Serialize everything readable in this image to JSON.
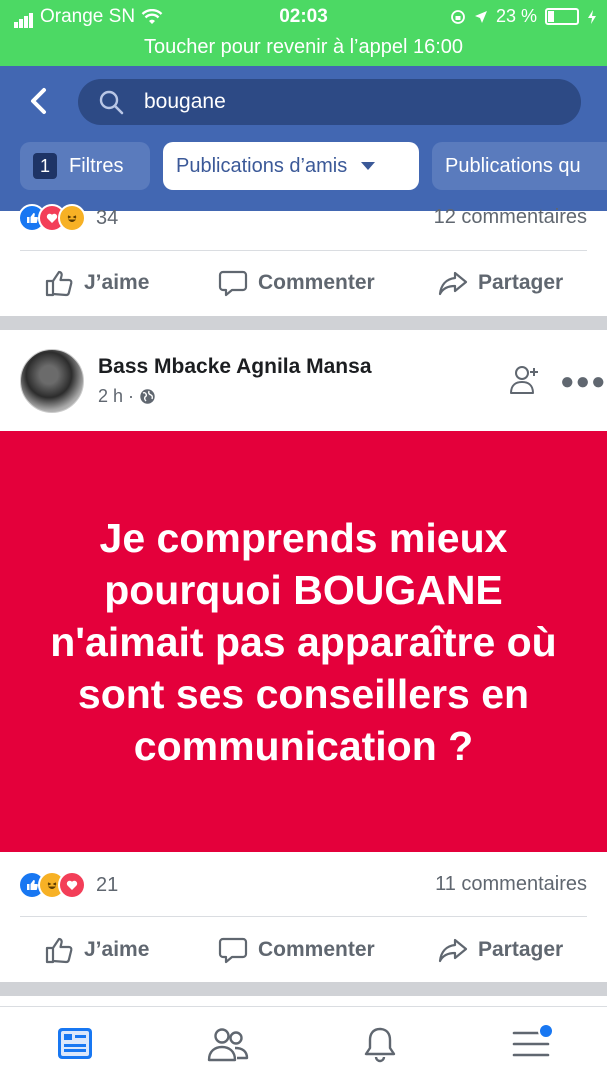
{
  "status_bar": {
    "carrier": "Orange SN",
    "time": "02:03",
    "battery": "23 %",
    "call_banner": "Toucher pour revenir à l’appel 16:00"
  },
  "search": {
    "query": "bougane"
  },
  "filters": {
    "count": "1",
    "filters_label": "Filtres",
    "friends_label": "Publications d’amis",
    "more_label": "Publications qu"
  },
  "post1": {
    "reaction_count": "34",
    "comments": "12 commentaires",
    "actions": {
      "like": "J’aime",
      "comment": "Commenter",
      "share": "Partager"
    }
  },
  "post2": {
    "author": "Bass Mbacke Agnila Mansa",
    "time": "2 h",
    "separator": "·",
    "image_text": "Je comprends mieux pourquoi BOUGANE n'aimait pas apparaître où sont ses conseillers en communication ?",
    "reaction_count": "21",
    "comments": "11 commentaires",
    "actions": {
      "like": "J’aime",
      "comment": "Commenter",
      "share": "Partager"
    }
  },
  "colors": {
    "status_green": "#4cd964",
    "header_blue": "#4267b2",
    "post_red": "#e4003b",
    "like_blue": "#1877f2"
  }
}
